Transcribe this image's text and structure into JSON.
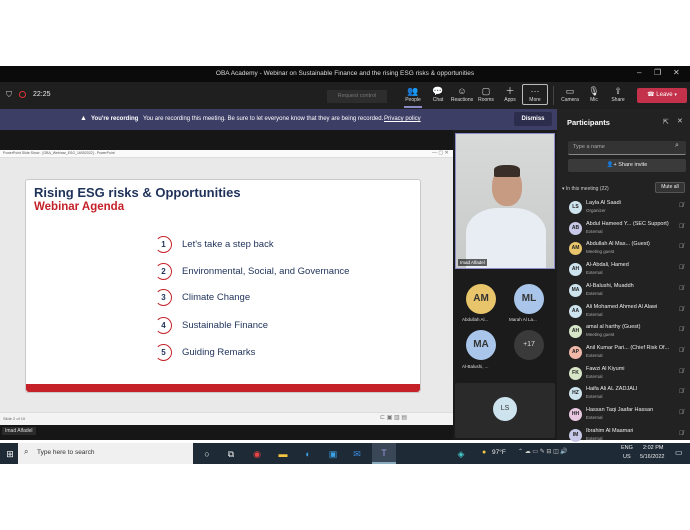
{
  "window": {
    "title": "OBA Academy - Webinar on Sustainable Finance and the rising ESG risks & opportunities"
  },
  "toolbar": {
    "timer": "22:25",
    "request_control": "Request control",
    "buttons": [
      {
        "label": "People",
        "icon": "people-icon"
      },
      {
        "label": "Chat",
        "icon": "chat-icon"
      },
      {
        "label": "Reactions",
        "icon": "reactions-icon"
      },
      {
        "label": "Rooms",
        "icon": "rooms-icon"
      },
      {
        "label": "Apps",
        "icon": "apps-icon"
      },
      {
        "label": "More",
        "icon": "more-icon"
      },
      {
        "label": "Camera",
        "icon": "camera-icon"
      },
      {
        "label": "Mic",
        "icon": "mic-icon"
      },
      {
        "label": "Share",
        "icon": "share-icon"
      }
    ],
    "leave_label": "Leave"
  },
  "recording": {
    "heading": "You're recording",
    "message": "You are recording this meeting. Be sure to let everyone know that they are being recorded.",
    "link": "Privacy policy",
    "dismiss": "Dismiss"
  },
  "ppt": {
    "header": "PowerPoint Slide Show - [OBA_Webinar_ESG_16052022] - PowerPoint",
    "status": "Slide 2 of 10"
  },
  "slide": {
    "title": "Rising ESG risks & Opportunities",
    "subtitle": "Webinar Agenda",
    "items": [
      {
        "num": "1",
        "text": "Let's take a step back"
      },
      {
        "num": "2",
        "text": "Environmental, Social, and Governance"
      },
      {
        "num": "3",
        "text": "Climate Change"
      },
      {
        "num": "4",
        "text": "Sustainable Finance"
      },
      {
        "num": "5",
        "text": "Guiding Remarks"
      }
    ]
  },
  "presenter": {
    "name": "Imad Alfadel"
  },
  "video_tiles": [
    {
      "initials": "AM",
      "name": "Abdullah Al...",
      "color": "#e8c46a"
    },
    {
      "initials": "ML",
      "name": "Marah Al La...",
      "color": "#a9c6ea"
    },
    {
      "initials": "MA",
      "name": "Al-Balushi, ...",
      "color": "#a9c6ea"
    },
    {
      "initials": "+17",
      "name": "",
      "color": "#3a3a3a"
    }
  ],
  "self_tile": {
    "initials": "LS",
    "color": "#cde3ee"
  },
  "participants": {
    "title": "Participants",
    "search_placeholder": "Type a name",
    "share_invite": "Share invite",
    "section": "In this meeting (22)",
    "mute_all": "Mute all",
    "list": [
      {
        "initials": "LS",
        "name": "Layla Al Saadi",
        "role": "Organizer",
        "color": "#cde3ee"
      },
      {
        "initials": "AB",
        "name": "Abdul Hameed Y... (SEC Support)",
        "role": "External",
        "color": "#c8c8e8"
      },
      {
        "initials": "AM",
        "name": "Abdullah Al Mas... (Guest)",
        "role": "Meeting guest",
        "color": "#e8c46a"
      },
      {
        "initials": "AH",
        "name": "Al-Abdali, Hamed",
        "role": "External",
        "color": "#cde3ee"
      },
      {
        "initials": "MA",
        "name": "Al-Balushi, Muaddh",
        "role": "External",
        "color": "#cde3ee"
      },
      {
        "initials": "AA",
        "name": "Ali Mohamed Ahmed Al Alawi",
        "role": "External",
        "color": "#cde3ee"
      },
      {
        "initials": "AH",
        "name": "amal al harthy (Guest)",
        "role": "Meeting guest",
        "color": "#d8e6c8"
      },
      {
        "initials": "AP",
        "name": "Anil Kumar Pari... (Chief Risk Of...",
        "role": "External",
        "color": "#f0b8a8"
      },
      {
        "initials": "FK",
        "name": "Fawzi Al Kiyumi",
        "role": "External",
        "color": "#d8e6c8"
      },
      {
        "initials": "HZ",
        "name": "Haifa Ali AL ZADJALI",
        "role": "External",
        "color": "#cde3ee"
      },
      {
        "initials": "HH",
        "name": "Hassan Taqi Jaafar Hassan",
        "role": "External",
        "color": "#e8c8e0"
      },
      {
        "initials": "IM",
        "name": "Ibrahim Al Maamari",
        "role": "External",
        "color": "#c8c8e8"
      }
    ]
  },
  "taskbar": {
    "search_placeholder": "Type here to search",
    "weather": "97°F",
    "lang": "ENG",
    "region": "US",
    "time": "2:02 PM",
    "date": "5/16/2022"
  },
  "colors": {
    "accent_red": "#c52129",
    "navy": "#1f3259",
    "teams_purple": "#464775",
    "leave_red": "#c4314b"
  }
}
